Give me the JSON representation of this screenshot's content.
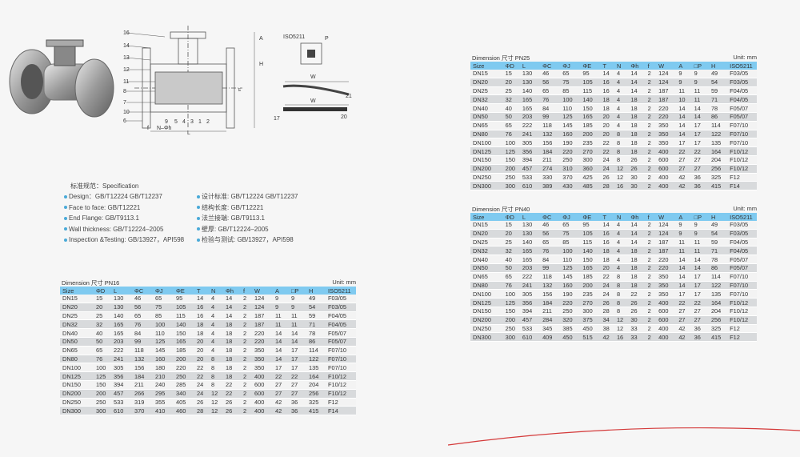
{
  "drawing": {
    "callouts_left": [
      "16",
      "14",
      "13",
      "12",
      "11",
      "8",
      "7",
      "10",
      "6"
    ],
    "callouts_bottom": [
      "9",
      "5",
      "4",
      "3",
      "1",
      "2"
    ],
    "dim_labels": {
      "f": "f",
      "n_phi_h": "N–Φh",
      "l": "L",
      "h": "H",
      "a": "A",
      "w": "W",
      "iso": "ISO5211",
      "p": "P",
      "e": "E"
    },
    "callouts_right": [
      "21",
      "17",
      "20"
    ]
  },
  "spec": {
    "title": "标准规范：Specification",
    "left": [
      "Design：GB/T12224  GB/T12237",
      "Face to face: GB/T12221",
      "End Flange: GB/T9113.1",
      "Wall thickness: GB/T12224–2005",
      "Inspection &Testing: GB/13927，API598"
    ],
    "right": [
      "设计标准: GB/T12224  GB/T12237",
      "结构长度: GB/T12221",
      "法兰接端: GB/T9113.1",
      "壁厚: GB/T12224–2005",
      "检验与测试: GB/13927，API598"
    ]
  },
  "tables": {
    "pn16": {
      "caption": "Dimension 尺寸 PN16",
      "unit": "Unit: mm",
      "headers": [
        "Size",
        "ΦD",
        "L",
        "ΦC",
        "ΦJ",
        "ΦE",
        "T",
        "N",
        "Φh",
        "f",
        "W",
        "A",
        "□P",
        "H",
        "ISO5211"
      ],
      "rows": [
        [
          "DN15",
          "15",
          "130",
          "46",
          "65",
          "95",
          "14",
          "4",
          "14",
          "2",
          "124",
          "9",
          "9",
          "49",
          "F03/05"
        ],
        [
          "DN20",
          "20",
          "130",
          "56",
          "75",
          "105",
          "16",
          "4",
          "14",
          "2",
          "124",
          "9",
          "9",
          "54",
          "F03/05"
        ],
        [
          "DN25",
          "25",
          "140",
          "65",
          "85",
          "115",
          "16",
          "4",
          "14",
          "2",
          "187",
          "11",
          "11",
          "59",
          "F04/05"
        ],
        [
          "DN32",
          "32",
          "165",
          "76",
          "100",
          "140",
          "18",
          "4",
          "18",
          "2",
          "187",
          "11",
          "11",
          "71",
          "F04/05"
        ],
        [
          "DN40",
          "40",
          "165",
          "84",
          "110",
          "150",
          "18",
          "4",
          "18",
          "2",
          "220",
          "14",
          "14",
          "78",
          "F05/07"
        ],
        [
          "DN50",
          "50",
          "203",
          "99",
          "125",
          "165",
          "20",
          "4",
          "18",
          "2",
          "220",
          "14",
          "14",
          "86",
          "F05/07"
        ],
        [
          "DN65",
          "65",
          "222",
          "118",
          "145",
          "185",
          "20",
          "4",
          "18",
          "2",
          "350",
          "14",
          "17",
          "114",
          "F07/10"
        ],
        [
          "DN80",
          "76",
          "241",
          "132",
          "160",
          "200",
          "20",
          "8",
          "18",
          "2",
          "350",
          "14",
          "17",
          "122",
          "F07/10"
        ],
        [
          "DN100",
          "100",
          "305",
          "156",
          "180",
          "220",
          "22",
          "8",
          "18",
          "2",
          "350",
          "17",
          "17",
          "135",
          "F07/10"
        ],
        [
          "DN125",
          "125",
          "356",
          "184",
          "210",
          "250",
          "22",
          "8",
          "18",
          "2",
          "400",
          "22",
          "22",
          "164",
          "F10/12"
        ],
        [
          "DN150",
          "150",
          "394",
          "211",
          "240",
          "285",
          "24",
          "8",
          "22",
          "2",
          "600",
          "27",
          "27",
          "204",
          "F10/12"
        ],
        [
          "DN200",
          "200",
          "457",
          "266",
          "295",
          "340",
          "24",
          "12",
          "22",
          "2",
          "600",
          "27",
          "27",
          "256",
          "F10/12"
        ],
        [
          "DN250",
          "250",
          "533",
          "319",
          "355",
          "405",
          "26",
          "12",
          "26",
          "2",
          "400",
          "42",
          "36",
          "325",
          "F12"
        ],
        [
          "DN300",
          "300",
          "610",
          "370",
          "410",
          "460",
          "28",
          "12",
          "26",
          "2",
          "400",
          "42",
          "36",
          "415",
          "F14"
        ]
      ]
    },
    "pn25": {
      "caption": "Dimension 尺寸  PN25",
      "unit": "Unit: mm",
      "headers": [
        "Size",
        "ΦD",
        "L",
        "ΦC",
        "ΦJ",
        "ΦE",
        "T",
        "N",
        "Φh",
        "f",
        "W",
        "A",
        "□P",
        "H",
        "ISO5211"
      ],
      "rows": [
        [
          "DN15",
          "15",
          "130",
          "46",
          "65",
          "95",
          "14",
          "4",
          "14",
          "2",
          "124",
          "9",
          "9",
          "49",
          "F03/05"
        ],
        [
          "DN20",
          "20",
          "130",
          "56",
          "75",
          "105",
          "16",
          "4",
          "14",
          "2",
          "124",
          "9",
          "9",
          "54",
          "F03/05"
        ],
        [
          "DN25",
          "25",
          "140",
          "65",
          "85",
          "115",
          "16",
          "4",
          "14",
          "2",
          "187",
          "11",
          "11",
          "59",
          "F04/05"
        ],
        [
          "DN32",
          "32",
          "165",
          "76",
          "100",
          "140",
          "18",
          "4",
          "18",
          "2",
          "187",
          "10",
          "11",
          "71",
          "F04/05"
        ],
        [
          "DN40",
          "40",
          "165",
          "84",
          "110",
          "150",
          "18",
          "4",
          "18",
          "2",
          "220",
          "14",
          "14",
          "78",
          "F05/07"
        ],
        [
          "DN50",
          "50",
          "203",
          "99",
          "125",
          "165",
          "20",
          "4",
          "18",
          "2",
          "220",
          "14",
          "14",
          "86",
          "F05/07"
        ],
        [
          "DN65",
          "65",
          "222",
          "118",
          "145",
          "185",
          "20",
          "4",
          "18",
          "2",
          "350",
          "14",
          "17",
          "114",
          "F07/10"
        ],
        [
          "DN80",
          "76",
          "241",
          "132",
          "160",
          "200",
          "20",
          "8",
          "18",
          "2",
          "350",
          "14",
          "17",
          "122",
          "F07/10"
        ],
        [
          "DN100",
          "100",
          "305",
          "156",
          "190",
          "235",
          "22",
          "8",
          "18",
          "2",
          "350",
          "17",
          "17",
          "135",
          "F07/10"
        ],
        [
          "DN125",
          "125",
          "356",
          "184",
          "220",
          "270",
          "22",
          "8",
          "18",
          "2",
          "400",
          "22",
          "22",
          "164",
          "F10/12"
        ],
        [
          "DN150",
          "150",
          "394",
          "211",
          "250",
          "300",
          "24",
          "8",
          "26",
          "2",
          "600",
          "27",
          "27",
          "204",
          "F10/12"
        ],
        [
          "DN200",
          "200",
          "457",
          "274",
          "310",
          "360",
          "24",
          "12",
          "26",
          "2",
          "600",
          "27",
          "27",
          "256",
          "F10/12"
        ],
        [
          "DN250",
          "250",
          "533",
          "330",
          "370",
          "425",
          "26",
          "12",
          "30",
          "2",
          "400",
          "42",
          "36",
          "325",
          "F12"
        ],
        [
          "DN300",
          "300",
          "610",
          "389",
          "430",
          "485",
          "28",
          "16",
          "30",
          "2",
          "400",
          "42",
          "36",
          "415",
          "F14"
        ]
      ]
    },
    "pn40": {
      "caption": "Dimension 尺寸  PN40",
      "unit": "Unit: mm",
      "headers": [
        "Size",
        "ΦD",
        "L",
        "ΦC",
        "ΦJ",
        "ΦE",
        "T",
        "N",
        "Φh",
        "f",
        "W",
        "A",
        "□P",
        "H",
        "ISO5211"
      ],
      "rows": [
        [
          "DN15",
          "15",
          "130",
          "46",
          "65",
          "95",
          "14",
          "4",
          "14",
          "2",
          "124",
          "9",
          "9",
          "49",
          "F03/05"
        ],
        [
          "DN20",
          "20",
          "130",
          "56",
          "75",
          "105",
          "16",
          "4",
          "14",
          "2",
          "124",
          "9",
          "9",
          "54",
          "F03/05"
        ],
        [
          "DN25",
          "25",
          "140",
          "65",
          "85",
          "115",
          "16",
          "4",
          "14",
          "2",
          "187",
          "11",
          "11",
          "59",
          "F04/05"
        ],
        [
          "DN32",
          "32",
          "165",
          "76",
          "100",
          "140",
          "18",
          "4",
          "18",
          "2",
          "187",
          "11",
          "11",
          "71",
          "F04/05"
        ],
        [
          "DN40",
          "40",
          "165",
          "84",
          "110",
          "150",
          "18",
          "4",
          "18",
          "2",
          "220",
          "14",
          "14",
          "78",
          "F05/07"
        ],
        [
          "DN50",
          "50",
          "203",
          "99",
          "125",
          "165",
          "20",
          "4",
          "18",
          "2",
          "220",
          "14",
          "14",
          "86",
          "F05/07"
        ],
        [
          "DN65",
          "65",
          "222",
          "118",
          "145",
          "185",
          "22",
          "8",
          "18",
          "2",
          "350",
          "14",
          "17",
          "114",
          "F07/10"
        ],
        [
          "DN80",
          "76",
          "241",
          "132",
          "160",
          "200",
          "24",
          "8",
          "18",
          "2",
          "350",
          "14",
          "17",
          "122",
          "F07/10"
        ],
        [
          "DN100",
          "100",
          "305",
          "156",
          "190",
          "235",
          "24",
          "8",
          "22",
          "2",
          "350",
          "17",
          "17",
          "135",
          "F07/10"
        ],
        [
          "DN125",
          "125",
          "356",
          "184",
          "220",
          "270",
          "26",
          "8",
          "26",
          "2",
          "400",
          "22",
          "22",
          "164",
          "F10/12"
        ],
        [
          "DN150",
          "150",
          "394",
          "211",
          "250",
          "300",
          "28",
          "8",
          "26",
          "2",
          "600",
          "27",
          "27",
          "204",
          "F10/12"
        ],
        [
          "DN200",
          "200",
          "457",
          "284",
          "320",
          "375",
          "34",
          "12",
          "30",
          "2",
          "600",
          "27",
          "27",
          "256",
          "F10/12"
        ],
        [
          "DN250",
          "250",
          "533",
          "345",
          "385",
          "450",
          "38",
          "12",
          "33",
          "2",
          "400",
          "42",
          "36",
          "325",
          "F12"
        ],
        [
          "DN300",
          "300",
          "610",
          "409",
          "450",
          "515",
          "42",
          "16",
          "33",
          "2",
          "400",
          "42",
          "36",
          "415",
          "F12"
        ]
      ]
    }
  }
}
